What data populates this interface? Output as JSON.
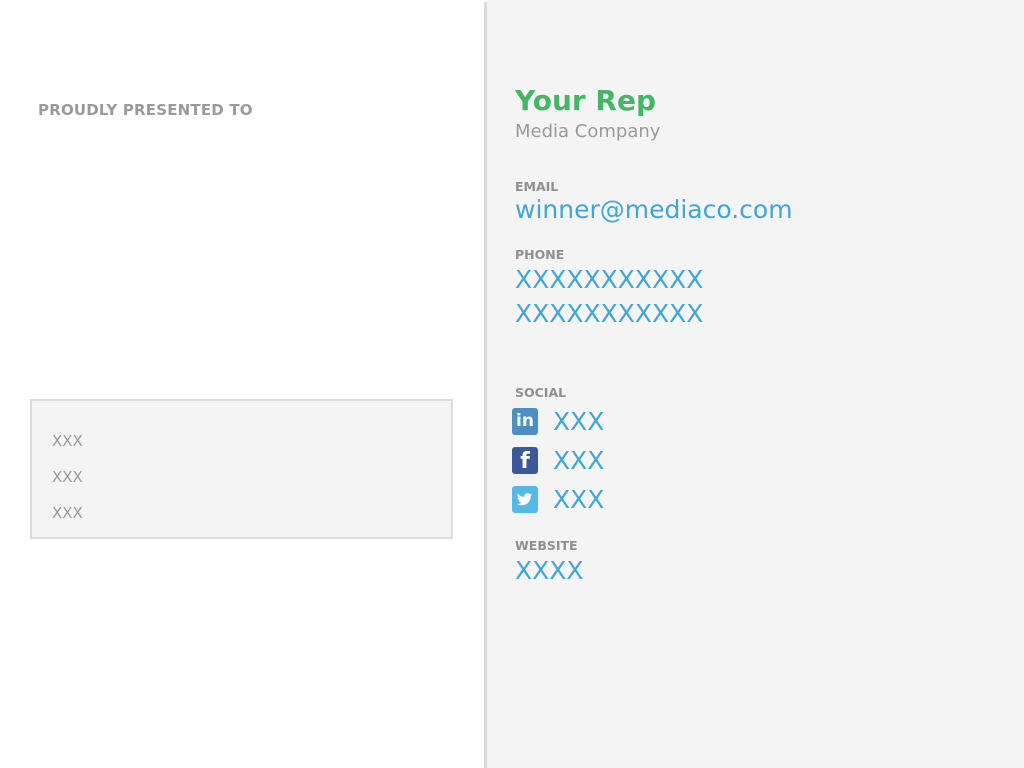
{
  "left": {
    "presented_label": "PROUDLY PRESENTED TO",
    "box_lines": [
      "XXX",
      "XXX",
      "XXX"
    ]
  },
  "rep": {
    "name": "Your Rep",
    "company": "Media Company"
  },
  "email": {
    "label": "EMAIL",
    "value": "winner@mediaco.com"
  },
  "phone": {
    "label": "PHONE",
    "values": [
      "XXXXXXXXXXX",
      "XXXXXXXXXXX"
    ]
  },
  "social": {
    "label": "SOCIAL",
    "items": [
      {
        "icon": "linkedin-icon",
        "glyph": "in",
        "value": "XXX",
        "color": "#4d90c0"
      },
      {
        "icon": "facebook-icon",
        "glyph": "f",
        "value": "XXX",
        "color": "#3b5998"
      },
      {
        "icon": "twitter-icon",
        "glyph": "t",
        "value": "XXX",
        "color": "#55b8e6"
      }
    ]
  },
  "website": {
    "label": "WEBSITE",
    "value": "XXXX"
  },
  "colors": {
    "accent_green": "#44b766",
    "link_blue": "#3fa6d6",
    "label_gray": "#8f8f8f"
  }
}
